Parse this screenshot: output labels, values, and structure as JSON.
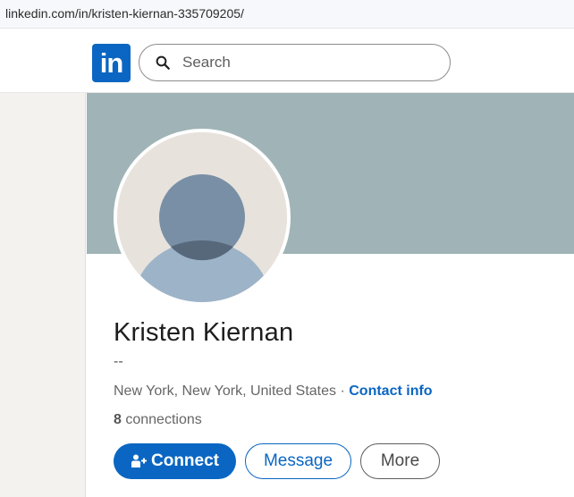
{
  "browser": {
    "url": "linkedin.com/in/kristen-kiernan-335709205/"
  },
  "nav": {
    "logo_text": "in",
    "logo_icon": "linkedin-logo",
    "search_placeholder": "Search",
    "search_icon": "search-icon"
  },
  "profile": {
    "name": "Kristen Kiernan",
    "headline": "--",
    "location": "New York, New York, United States",
    "separator": " · ",
    "contact_info_label": "Contact info",
    "connections_count": "8",
    "connections_label": " connections",
    "avatar": "default-profile-silhouette"
  },
  "actions": {
    "connect_label": "Connect",
    "message_label": "Message",
    "more_label": "More"
  },
  "colors": {
    "brand": "#0a66c2",
    "cover": "#a0b4b7"
  }
}
